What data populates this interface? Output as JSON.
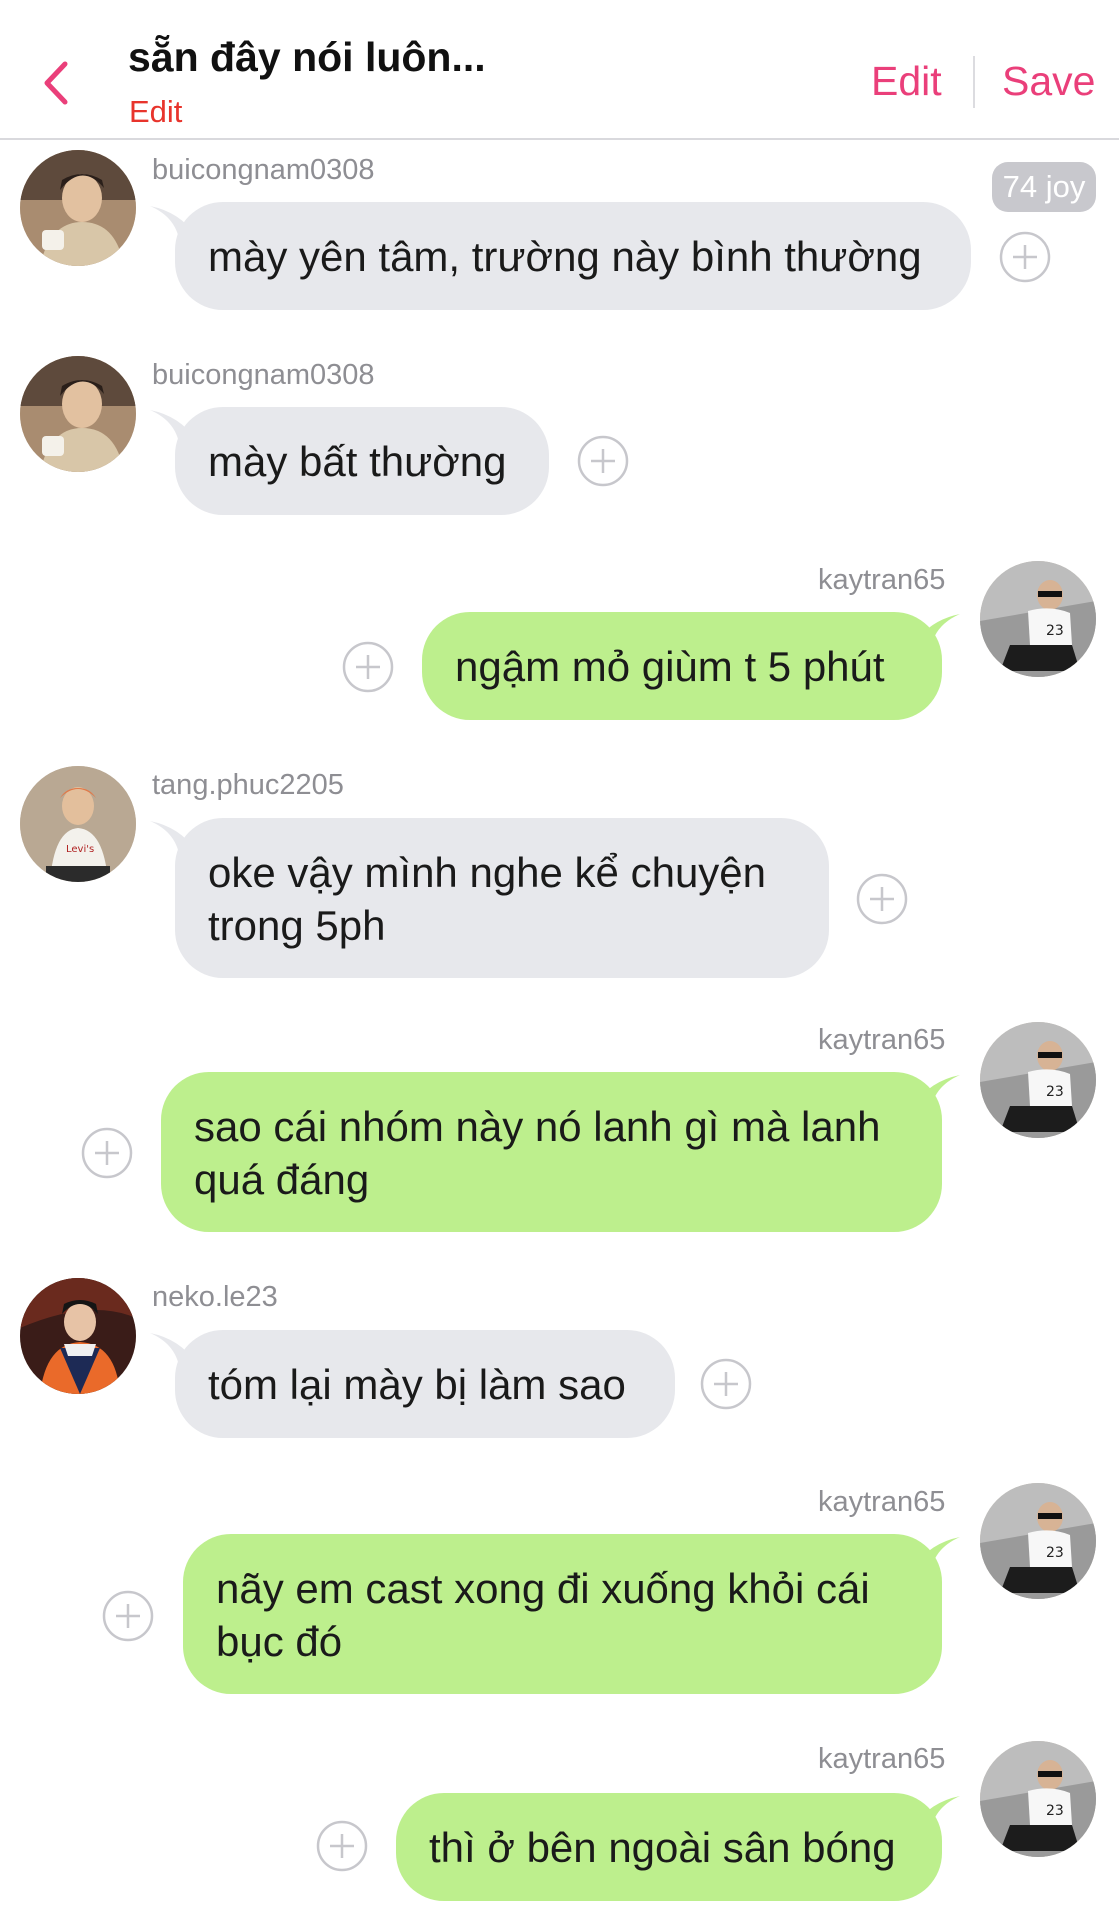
{
  "header": {
    "title": "sẵn đây nói luôn...",
    "subtitle": "Edit",
    "edit_label": "Edit",
    "save_label": "Save"
  },
  "badge": {
    "label": "74 joy"
  },
  "messages": [
    {
      "username": "buicongnam0308",
      "text": "mày yên tâm, trường này bình thường",
      "side": "incoming"
    },
    {
      "username": "buicongnam0308",
      "text": "mày bất thường",
      "side": "incoming"
    },
    {
      "username": "kaytran65",
      "text": "ngậm mỏ giùm t 5 phút",
      "side": "outgoing"
    },
    {
      "username": "tang.phuc2205",
      "text_line1": "oke vậy mình nghe kể chuyện",
      "text_line2": "trong 5ph",
      "side": "incoming"
    },
    {
      "username": "kaytran65",
      "text_line1": "sao cái nhóm này nó lanh gì mà lanh",
      "text_line2": "quá đáng",
      "side": "outgoing"
    },
    {
      "username": "neko.le23",
      "text": "tóm lại mày bị làm sao",
      "side": "incoming"
    },
    {
      "username": "kaytran65",
      "text_line1": "nãy em cast xong đi xuống khỏi cái",
      "text_line2": "bục đó",
      "side": "outgoing"
    },
    {
      "username": "kaytran65",
      "text": "thì ở bên ngoài sân bóng",
      "side": "outgoing"
    }
  ],
  "colors": {
    "accent": "#ea3f7a",
    "subtitle": "#e8342c",
    "incoming_bubble": "#e7e8ec",
    "outgoing_bubble": "#bdef8d"
  }
}
